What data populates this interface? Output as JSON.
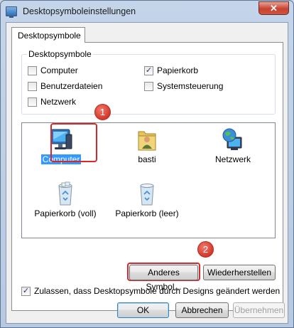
{
  "window": {
    "title": "Desktopsymboleinstellungen",
    "close_glyph": "✕"
  },
  "tab": {
    "label": "Desktopsymbole"
  },
  "group": {
    "title": "Desktopsymbole",
    "checkboxes": [
      {
        "label": "Computer",
        "checked": false
      },
      {
        "label": "Papierkorb",
        "checked": true
      },
      {
        "label": "Benutzerdateien",
        "checked": false
      },
      {
        "label": "Systemsteuerung",
        "checked": false
      },
      {
        "label": "Netzwerk",
        "checked": false
      }
    ]
  },
  "icons": [
    {
      "label": "Computer",
      "icon": "computer-icon",
      "selected": true
    },
    {
      "label": "basti",
      "icon": "user-folder-icon",
      "selected": false
    },
    {
      "label": "Netzwerk",
      "icon": "network-globe-icon",
      "selected": false
    },
    {
      "label": "Papierkorb (voll)",
      "icon": "recycle-bin-full-icon",
      "selected": false
    },
    {
      "label": "Papierkorb (leer)",
      "icon": "recycle-bin-empty-icon",
      "selected": false
    }
  ],
  "annotations": {
    "badge1": "1",
    "badge2": "2"
  },
  "buttons": {
    "change_icon": "Anderes Symbol...",
    "restore": "Wiederherstellen",
    "ok": "OK",
    "cancel": "Abbrechen",
    "apply": "Übernehmen"
  },
  "themes_checkbox": {
    "label": "Zulassen, dass Desktopsymbole durch Designs geändert werden",
    "checked": true
  },
  "check_glyph": "✓",
  "colors": {
    "selection": "#3399ff",
    "annotation": "#d9272e"
  }
}
